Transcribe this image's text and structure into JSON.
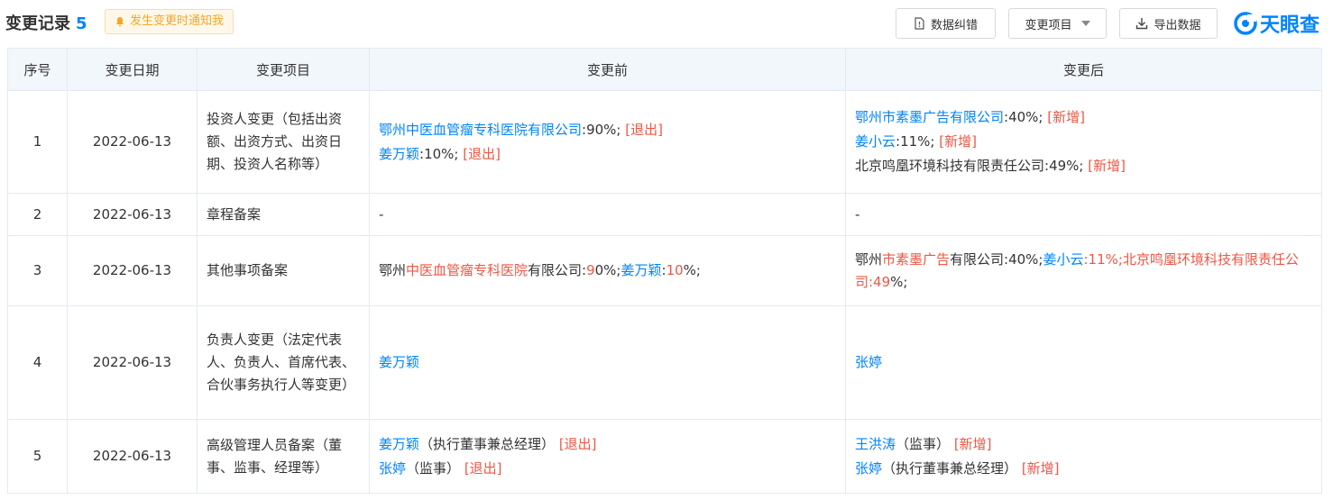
{
  "header": {
    "title": "变更记录",
    "count": "5",
    "notify_label": "发生变更时通知我",
    "correct_label": "数据纠错",
    "filter_label": "变更项目",
    "export_label": "导出数据",
    "logo_text": "天眼查"
  },
  "colors": {
    "link": "#0084ff",
    "tag": "#ef5644",
    "header_bg": "#f2f7fc",
    "border": "#e4eaf2"
  },
  "table": {
    "columns": [
      "序号",
      "变更日期",
      "变更项目",
      "变更前",
      "变更后"
    ],
    "rows": [
      {
        "index": "1",
        "date": "2022-06-13",
        "item": "投资人变更（包括出资额、出资方式、出资日期、投资人名称等）",
        "before": [
          {
            "name": "鄂州中医血管瘤专科医院有限公司",
            "share": ":90%;",
            "tag": "[退出]"
          },
          {
            "name": "姜万颖",
            "share": ":10%;",
            "tag": "[退出]"
          }
        ],
        "after": [
          {
            "name": "鄂州市素墨广告有限公司",
            "share": ":40%;",
            "tag": "[新增]"
          },
          {
            "name": "姜小云",
            "share": ":11%;",
            "tag": "[新增]"
          },
          {
            "name": "北京鸣凰环境科技有限责任公司",
            "share": ":49%;",
            "tag": "[新增]"
          }
        ]
      },
      {
        "index": "2",
        "date": "2022-06-13",
        "item": "章程备案",
        "before_text": "-",
        "after_text": "-"
      },
      {
        "index": "3",
        "date": "2022-06-13",
        "item": "其他事项备案",
        "before_parts": [
          {
            "t": "鄂州",
            "c": "n"
          },
          {
            "t": "中医血管瘤专科医院",
            "c": "r"
          },
          {
            "t": "有限公司:",
            "c": "n"
          },
          {
            "t": "9",
            "c": "r"
          },
          {
            "t": "0%;",
            "c": "n"
          },
          {
            "t": "姜万颖",
            "c": "b"
          },
          {
            "t": ":",
            "c": "n"
          },
          {
            "t": "10",
            "c": "r"
          },
          {
            "t": "%;",
            "c": "n"
          }
        ],
        "after_parts": [
          {
            "t": "鄂州",
            "c": "n"
          },
          {
            "t": "市素墨广告",
            "c": "r"
          },
          {
            "t": "有限公司:40%;",
            "c": "n"
          },
          {
            "t": "姜小云",
            "c": "b"
          },
          {
            "t": ":11%;北京鸣凰环境科技有限责任公司:49",
            "c": "r"
          },
          {
            "t": "%;",
            "c": "n"
          }
        ]
      },
      {
        "index": "4",
        "date": "2022-06-13",
        "item": "负责人变更（法定代表人、负责人、首席代表、合伙事务执行人等变更）",
        "before_name": "姜万颖",
        "after_name": "张婷"
      },
      {
        "index": "5",
        "date": "2022-06-13",
        "item": "高级管理人员备案（董事、监事、经理等）",
        "before": [
          {
            "name": "姜万颖",
            "role": "（执行董事兼总经理）",
            "tag": "[退出]"
          },
          {
            "name": "张婷",
            "role": "（监事）",
            "tag": "[退出]"
          }
        ],
        "after": [
          {
            "name": "王洪涛",
            "role": "（监事）",
            "tag": "[新增]"
          },
          {
            "name": "张婷",
            "role": "（执行董事兼总经理）",
            "tag": "[新增]"
          }
        ]
      }
    ]
  }
}
